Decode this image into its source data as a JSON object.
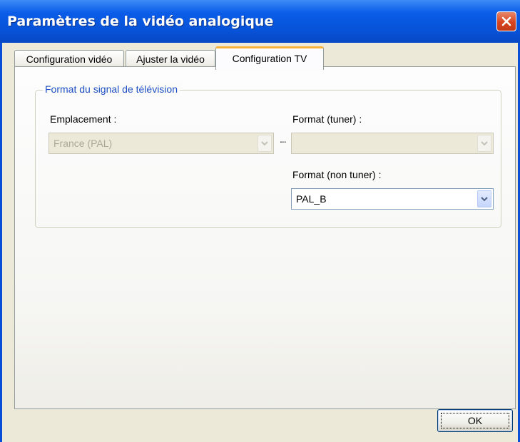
{
  "window": {
    "title": "Paramètres de la vidéo analogique",
    "close_icon": "close-icon"
  },
  "tabs": [
    {
      "label": "Configuration vidéo",
      "active": false
    },
    {
      "label": "Ajuster la vidéo",
      "active": false
    },
    {
      "label": "Configuration TV",
      "active": true
    }
  ],
  "group": {
    "legend": "Format du signal de télévision",
    "location_label": "Emplacement :",
    "location_value": "France (PAL)",
    "location_enabled": false,
    "ellipsis": "...",
    "tuner_label": "Format (tuner) :",
    "tuner_value": "",
    "tuner_enabled": false,
    "non_tuner_label": "Format (non tuner) :",
    "non_tuner_value": "PAL_B",
    "non_tuner_enabled": true
  },
  "footer": {
    "ok_label": "OK"
  },
  "colors": {
    "title_bar": "#0a5ce8",
    "close_button": "#d8441f",
    "active_tab_accent": "#f6b23d",
    "group_legend": "#1e4fc4",
    "dialog_face": "#ece9d8"
  }
}
